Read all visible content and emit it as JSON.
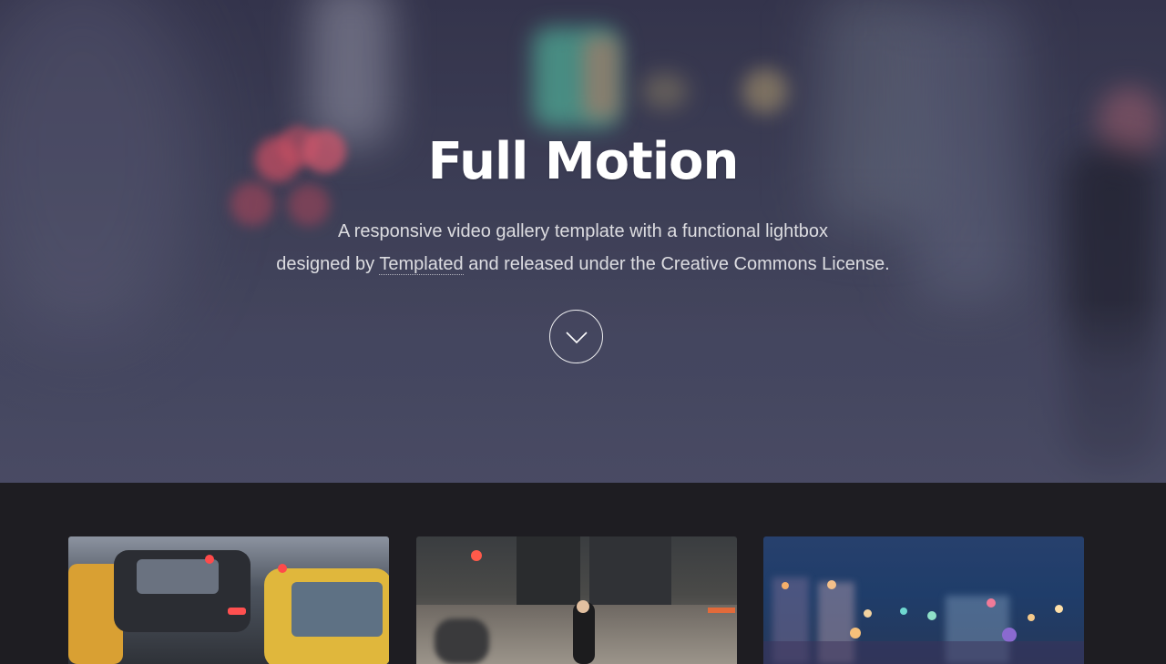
{
  "banner": {
    "title": "Full Motion",
    "text_line1": "A responsive video gallery template with a functional lightbox",
    "text_prefix": "designed by ",
    "link_text": "Templated",
    "text_suffix": " and released under the Creative Commons License.",
    "scroll_icon": "chevron-down-icon"
  },
  "gallery": {
    "thumbnails": [
      {
        "icon": "traffic-taxis-image"
      },
      {
        "icon": "city-cyclist-image"
      },
      {
        "icon": "city-bokeh-night-image"
      }
    ]
  },
  "colors": {
    "page_background": "#1e1d22",
    "banner_tint": "#45475f",
    "text_primary": "#ffffff"
  }
}
